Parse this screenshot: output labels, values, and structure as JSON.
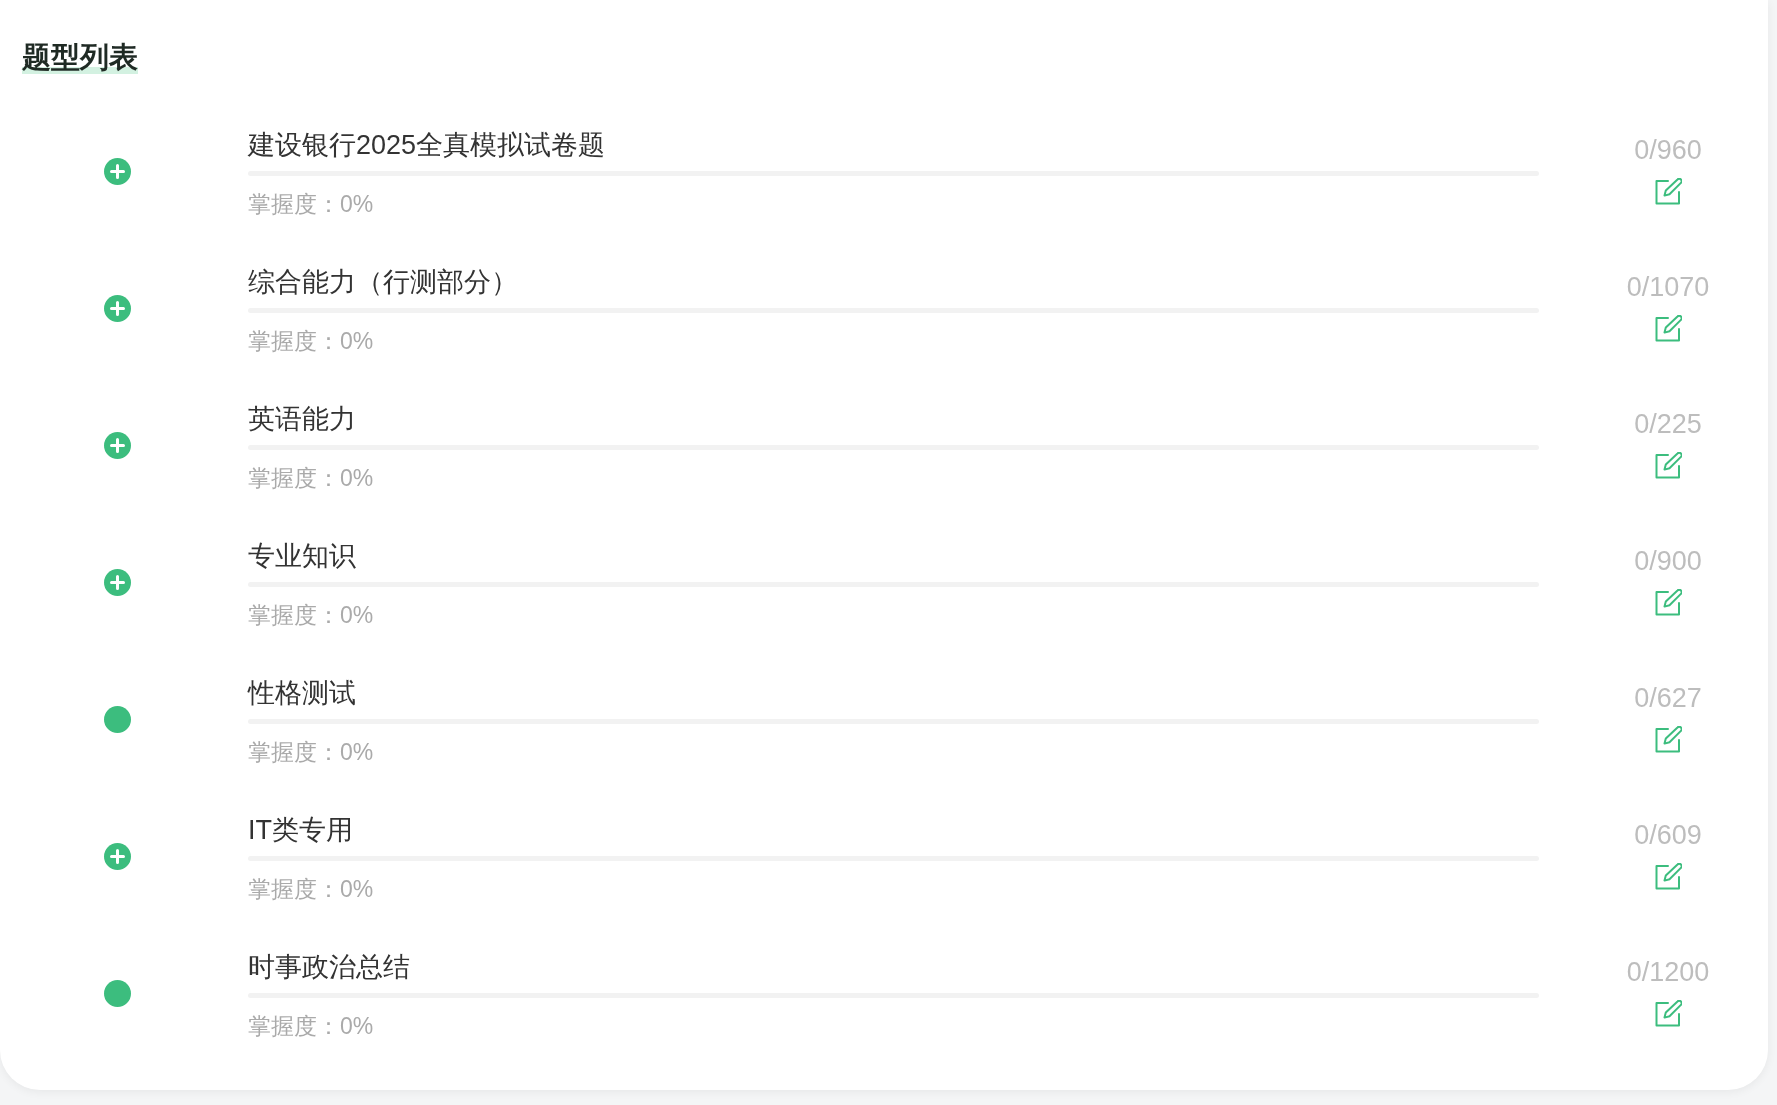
{
  "section": {
    "title": "题型列表"
  },
  "items": [
    {
      "kind": "group",
      "title": "建设银行2025全真模拟试卷题",
      "level": 0,
      "mastery": "掌握度：0%",
      "count": "0/960"
    },
    {
      "kind": "group",
      "title": "综合能力（行测部分）",
      "level": 0,
      "mastery": "掌握度：0%",
      "count": "0/1070"
    },
    {
      "kind": "group",
      "title": "英语能力",
      "level": 0,
      "mastery": "掌握度：0%",
      "count": "0/225"
    },
    {
      "kind": "group",
      "title": "专业知识",
      "level": 0,
      "mastery": "掌握度：0%",
      "count": "0/900"
    },
    {
      "kind": "leaf",
      "title": "性格测试",
      "level": 0,
      "mastery": "掌握度：0%",
      "count": "0/627"
    },
    {
      "kind": "group",
      "title": "IT类专用",
      "level": 0,
      "mastery": "掌握度：0%",
      "count": "0/609"
    },
    {
      "kind": "leaf",
      "title": "时事政治总结",
      "level": 0,
      "mastery": "掌握度：0%",
      "count": "0/1200"
    }
  ]
}
